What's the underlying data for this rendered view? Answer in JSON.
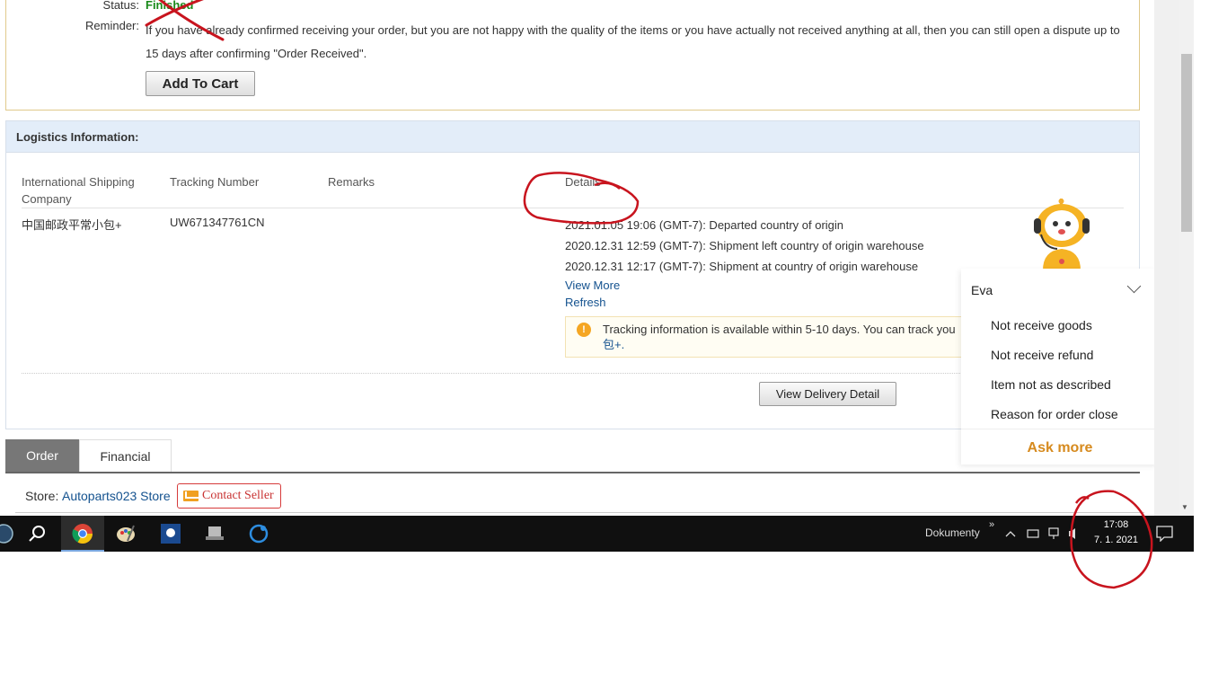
{
  "order": {
    "status_label": "Status:",
    "status_value": "Finished",
    "reminder_label": "Reminder:",
    "reminder_text": "If you have already confirmed receiving your order, but you are not happy with the quality of the items or you have actually not received anything at all, then you can still open a dispute up to 15 days after confirming \"Order Received\".",
    "add_to_cart": "Add To Cart"
  },
  "logistics": {
    "title": "Logistics Information:",
    "columns": {
      "company": "International Shipping Company",
      "tracking": "Tracking Number",
      "remarks": "Remarks",
      "details": "Details"
    },
    "company": "中国邮政平常小包+",
    "tracking_number": "UW671347761CN",
    "events": [
      "2021.01.05 19:06 (GMT-7): Departed country of origin",
      "2020.12.31 12:59 (GMT-7): Shipment left country of origin warehouse",
      "2020.12.31 12:17 (GMT-7): Shipment at country of origin warehouse"
    ],
    "view_more": "View More",
    "refresh": "Refresh",
    "tip_line1": "Tracking information is available within 5-10 days. You can track you",
    "tip_line2": "包+.",
    "view_delivery": "View Delivery Detail"
  },
  "tabs": {
    "order": "Order",
    "financial": "Financial"
  },
  "store": {
    "label": "Store:",
    "name": "Autoparts023 Store",
    "contact": "Contact Seller"
  },
  "chat": {
    "name": "Eva",
    "items": [
      "Not receive goods",
      "Not receive refund",
      "Item not as described",
      "Reason for order close"
    ],
    "ask_more": "Ask more"
  },
  "taskbar": {
    "folder": "Dokumenty",
    "chevron": "»",
    "time": "17:08",
    "date": "7. 1. 2021",
    "icons": [
      "windows-start-icon",
      "search-icon",
      "chrome-icon",
      "paint-icon",
      "app-icon",
      "laptop-icon",
      "refresh-app-icon"
    ]
  },
  "colors": {
    "accent_link": "#14528f",
    "status_green": "#1a8a1a",
    "ask_more": "#d68a1e",
    "annotation_red": "#c8141e"
  }
}
